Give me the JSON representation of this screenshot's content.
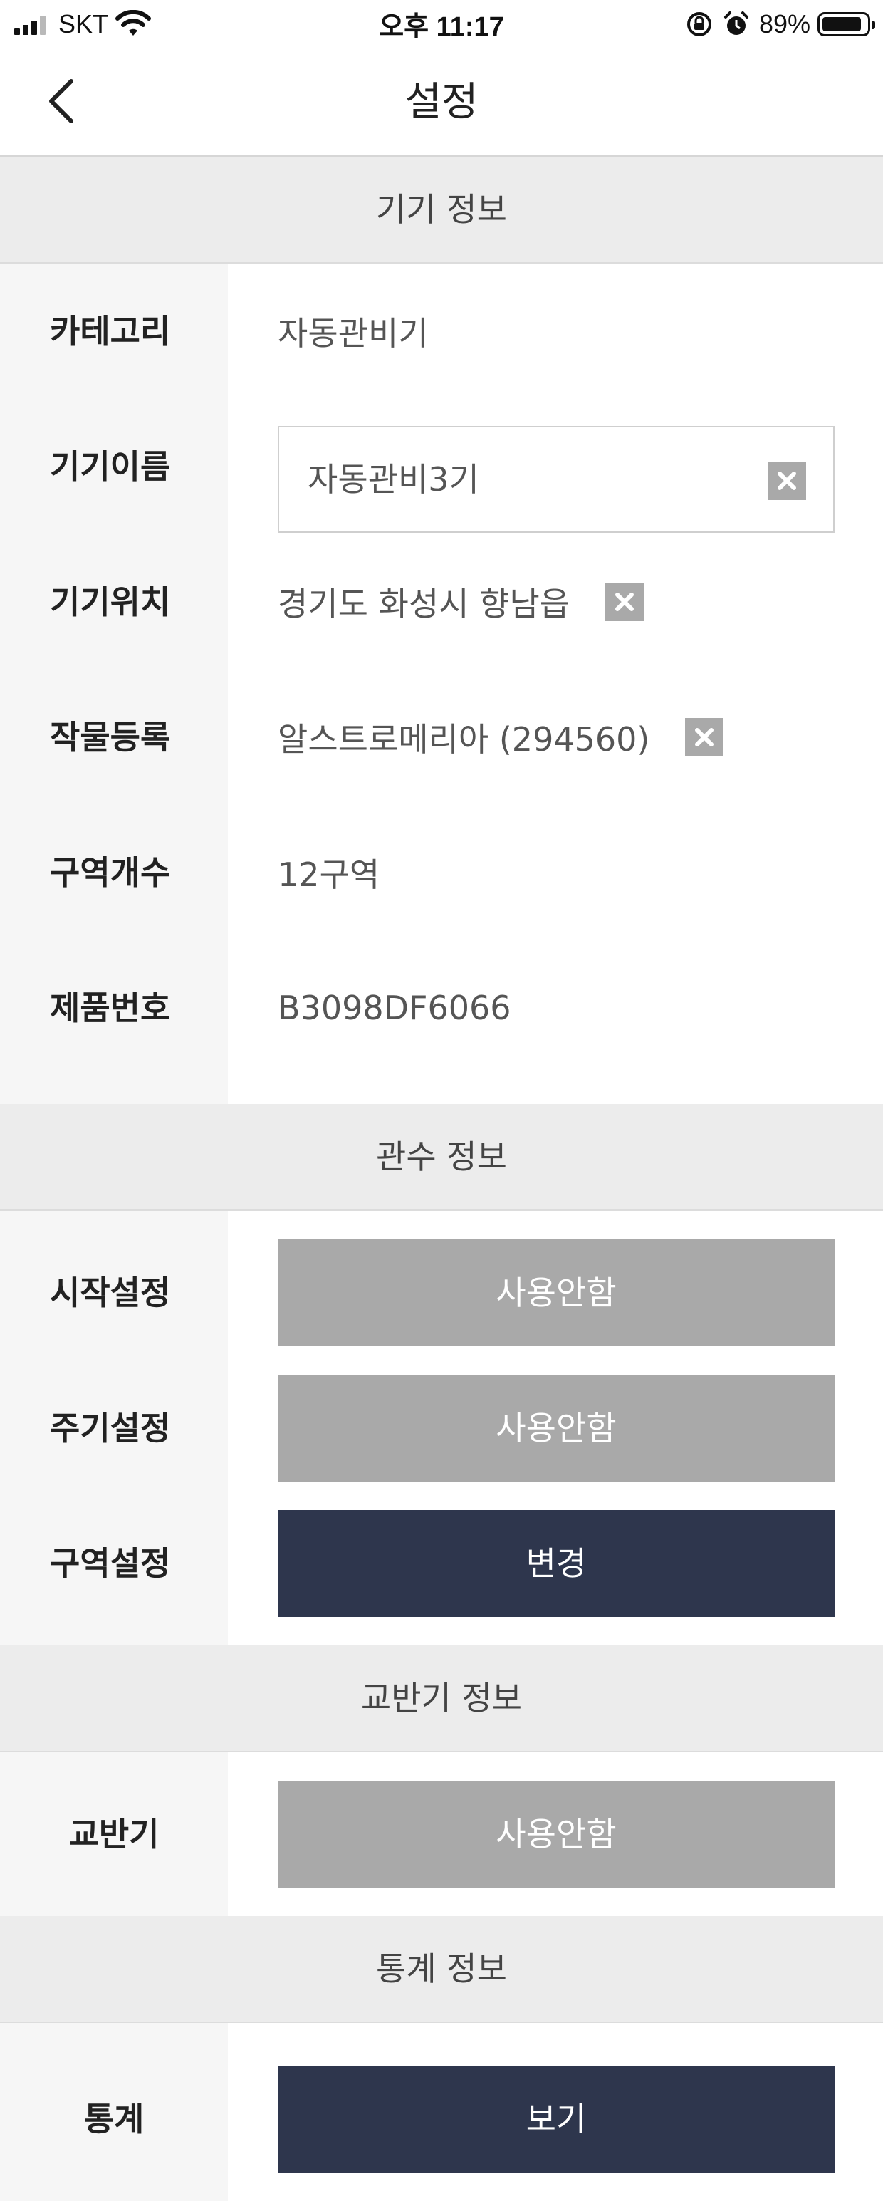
{
  "status_bar": {
    "carrier": "SKT",
    "time": "오후 11:17",
    "battery_percent": "89%",
    "battery_level": 0.89
  },
  "nav": {
    "title": "설정",
    "back_icon": "chevron-left-icon"
  },
  "device_info": {
    "header": "기기 정보",
    "category_label": "카테고리",
    "category_value": "자동관비기",
    "name_label": "기기이름",
    "name_value": "자동관비3기",
    "location_label": "기기위치",
    "location_value": "경기도 화성시 향남읍",
    "crop_label": "작물등록",
    "crop_value": "알스트로메리아 (294560)",
    "zone_count_label": "구역개수",
    "zone_count_value": "12구역",
    "serial_label": "제품번호",
    "serial_value": "B3098DF6066"
  },
  "irrigation_info": {
    "header": "관수 정보",
    "start_label": "시작설정",
    "start_button": "사용안함",
    "cycle_label": "주기설정",
    "cycle_button": "사용안함",
    "zone_label": "구역설정",
    "zone_button": "변경"
  },
  "mixer_info": {
    "header": "교반기 정보",
    "mixer_label": "교반기",
    "mixer_button": "사용안함"
  },
  "stats_info": {
    "header": "통계 정보",
    "stats_label": "통계",
    "stats_button": "보기"
  },
  "colors": {
    "disabled_button": "#a9a9a9",
    "primary_button": "#2e364d",
    "section_header_bg": "#ececec",
    "label_column_bg": "#f6f6f6"
  }
}
